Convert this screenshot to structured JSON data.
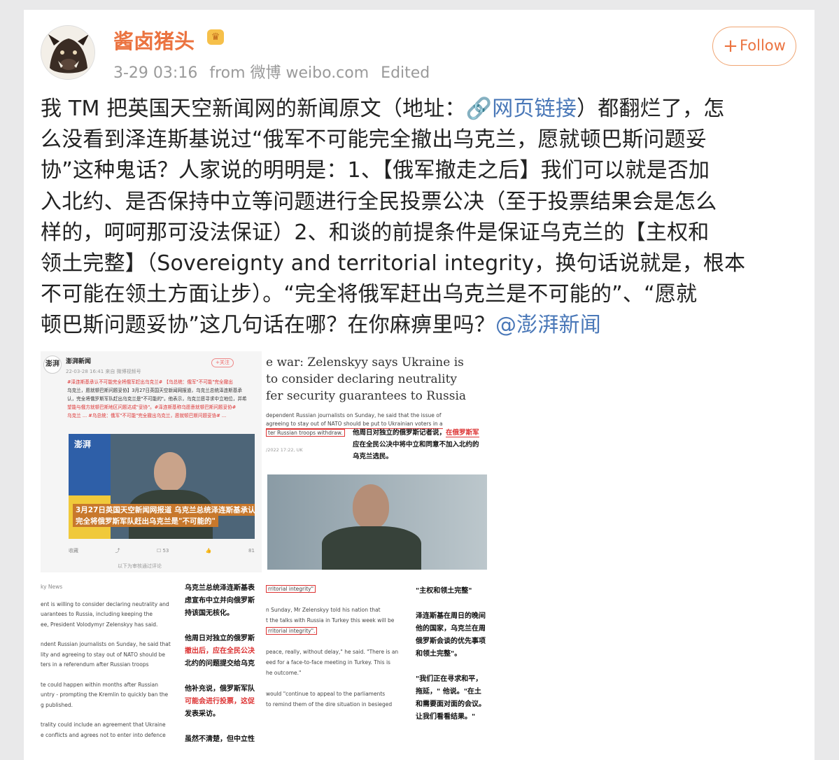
{
  "post": {
    "username": "酱卤猪头",
    "timestamp": "3-29 03:16",
    "source": "from 微博 weibo.com",
    "edited": "Edited",
    "follow_label": "Follow",
    "text_lines": [
      "我 TM 把英国天空新闻网的新闻原文（地址：",
      "网页链接",
      "）都翻烂了，怎",
      "么没看到泽连斯基说过“俄军不可能完全撤出乌克兰，愿就顿巴斯问题妥",
      "协”这种鬼话？人家说的明明是：1、【俄军撤走之后】我们可以就是否加",
      "入北约、是否保持中立等问题进行全民投票公决（至于投票结果会是怎么",
      "样的，呵呵那可没法保证）2、和谈的前提条件是保证乌克兰的【主权和",
      "领土完整】（Sovereignty and territorial integrity，换句话说就是，根本",
      "不可能在领土方面让步）。“完全将俄军赶出乌克兰是不可能的”、“愿就",
      "顿巴斯问题妥协”这几句话在哪？在你麻痹里吗？",
      "@澎湃新闻"
    ]
  },
  "images": {
    "s1": {
      "account": "澎湃新闻",
      "follow": "+关注",
      "date": "22-03-28 16:41 来自 微博视频号",
      "body_lines": [
        "#泽连斯基承认不可能完全将俄军赶出乌克兰# 【乌总统：俄军\"不可能\"完全撤出",
        "乌克兰，愿就顿巴斯问题妥协】3月27日英国天空新闻网报道，乌克兰总统泽连斯基承",
        "认，完全将俄罗斯军队赶出乌克兰是\"不可能的\"。他表示，乌克兰愿寻求中立地位，并希",
        "望能与俄方就顿巴斯地区问题达成\"妥协\"。#泽连斯基称乌愿意就顿巴斯问题妥协#",
        "乌克兰 ... #乌总统：俄军\"不可能\"完全撤出乌克兰，愿就顿巴斯问题妥协# ..."
      ],
      "video_logo": "澎湃",
      "caption1": "3月27日英国天空新闻网报道 乌克兰总统泽连斯基承认",
      "caption2": "完全将俄罗斯军队赶出乌克兰是\"不可能的\"",
      "actions": [
        "收藏",
        "",
        "53",
        "",
        "81"
      ],
      "comment_hint": "以下为审核通过评论"
    },
    "s2": {
      "headline": [
        "e war: Zelenskyy says Ukraine is",
        "to consider declaring neutrality",
        "fer security guarantees to Russia"
      ],
      "en1": "dependent Russian journalists on Sunday, he said that the issue of",
      "en2": "agreeing to stay out of NATO should be put to Ukrainian voters in a",
      "en3": "ter Russian troops withdraw.",
      "date": "/2022 17:22, UK",
      "cn1_pre": "他周日对独立的俄罗斯记者说，",
      "cn1_red": "在俄罗斯军",
      "cn2": "应在全民公决中将中立和同意不加入北约的",
      "cn3": "乌克兰选民。"
    },
    "s3": {
      "source": "ky News",
      "en_lines": [
        "ent is willing to consider declaring neutrality and",
        "uarantees to Russia, including keeping the",
        "ee, President Volodymyr Zelenskyy has said.",
        "",
        "ndent Russian journalists on Sunday, he said that",
        "lity and agreeing to stay out of NATO should be",
        "ters in a referendum after Russian troops",
        "",
        "te could happen within months after Russian",
        "untry - prompting the Kremlin to quickly ban the",
        "g published.",
        "",
        "trality could include an agreement that Ukraine",
        "e conflicts and agrees not to enter into defence"
      ],
      "cn_lines": [
        "乌克兰总统泽连斯基表",
        "虑宣布中立并向俄罗斯",
        "持该国无核化。",
        "",
        "他周日对独立的俄罗斯",
        "撤出后，应在全民公决",
        "北约的问题提交给乌克",
        "",
        "他补充说，俄罗斯军队",
        "可能会进行投票，这促",
        "发表采访。",
        "",
        "虽然不清楚，但中立性"
      ]
    },
    "s4": {
      "en_lines": [
        "rritorial integrity\"",
        "",
        "n Sunday, Mr Zelenskyy told his nation that",
        "t the talks with Russia in Turkey this week will be",
        "rritorial integrity\".",
        "",
        "peace, really, without delay,\" he said. \"There is an",
        "eed for a face-to-face meeting in Turkey. This is",
        "he outcome.\"",
        "",
        "would \"continue to appeal to the parliaments",
        "to remind them of the dire situation in besieged"
      ],
      "cn_lines": [
        "\"主权和领土完整\"",
        "",
        "泽连斯基在周日的晚间",
        "他的国家，乌克兰在周",
        "俄罗斯会谈的优先事项",
        "和领土完整\"。",
        "",
        "\"我们正在寻求和平，",
        "拖延，\" 他说。\"在土",
        "和需要面对面的会议。",
        "让我们看看结果。\""
      ]
    }
  },
  "colors": {
    "accent": "#eb7340",
    "link": "#4a78b8",
    "highlight_red": "#d33333"
  }
}
